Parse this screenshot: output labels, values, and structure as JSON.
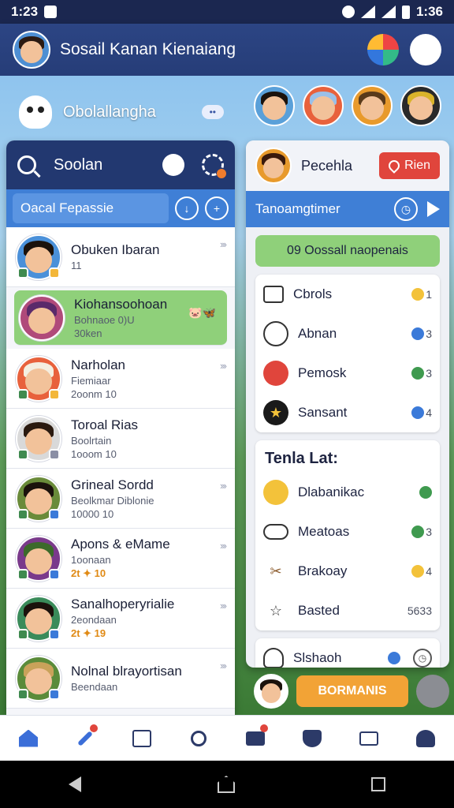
{
  "status_bar": {
    "time_left": "1:23",
    "time_right": "1:36"
  },
  "header": {
    "title": "Sosail Kanan Kienaiang"
  },
  "left_info": {
    "title": "Obolallangha",
    "badge": "••"
  },
  "search": {
    "label": "Soolan"
  },
  "left_tab": {
    "label": "Oacal Fepassie"
  },
  "contacts": [
    {
      "name": "Obuken Ibaran",
      "sub": "11",
      "meta": ""
    },
    {
      "name": "Kiohansoohoan",
      "sub": "Bohnaoe 0)U",
      "meta": "30ken"
    },
    {
      "name": "Narholan",
      "sub": "Fiemiaar",
      "meta": "2oonm 10"
    },
    {
      "name": "Toroal Rias",
      "sub": "Boolrtain",
      "meta": "1ooom 10"
    },
    {
      "name": "Grineal Sordd",
      "sub": "Beolkmar Diblonie",
      "meta": "10000 10"
    },
    {
      "name": "Apons & eMame",
      "sub": "1oonaan",
      "meta": "2t ✦ 10"
    },
    {
      "name": "Sanalhoperyrialie",
      "sub": "2eondaan",
      "meta": "2t ✦ 19"
    },
    {
      "name": "Nolnal blrayortisan",
      "sub": "Beendaan",
      "meta": ""
    }
  ],
  "right_head": {
    "label": "Pecehla",
    "button": "Rien"
  },
  "right_tab": {
    "label": "Tanoamgtimer"
  },
  "green_pill": {
    "label": "09 Oossall naopenais"
  },
  "card1": [
    {
      "label": "Cbrols",
      "count": "1"
    },
    {
      "label": "Abnan",
      "count": "3"
    },
    {
      "label": "Pemosk",
      "count": "3"
    },
    {
      "label": "Sansant",
      "count": "4"
    }
  ],
  "card2": {
    "title": "Tenla Lat:",
    "items": [
      {
        "label": "Dlabanikac",
        "count": ""
      },
      {
        "label": "Meatoas",
        "count": "3"
      },
      {
        "label": "Brakoay",
        "count": "4"
      },
      {
        "label": "Basted",
        "count": "5633"
      }
    ]
  },
  "card3": {
    "label": "Slshaoh"
  },
  "orange_button": {
    "label": "BORMANIS"
  },
  "colors": {
    "primary": "#223870",
    "accent_blue": "#3f7fd6",
    "green": "#8fd07a",
    "red": "#e0453c",
    "orange": "#f2a336"
  }
}
